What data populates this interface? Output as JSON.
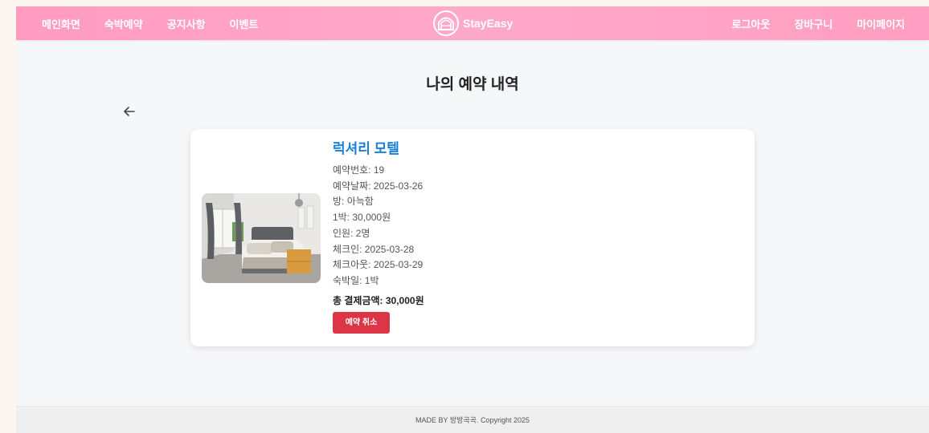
{
  "header": {
    "nav_left": [
      "메인화면",
      "숙박예약",
      "공지사항",
      "이벤트"
    ],
    "brand": "StayEasy",
    "nav_right": [
      "로그아웃",
      "장바구니",
      "마이페이지"
    ]
  },
  "page": {
    "title": "나의 예약 내역"
  },
  "reservation": {
    "hotel_name": "럭셔리 모텔",
    "lines": [
      "예약번호: 19",
      "예약날짜: 2025-03-26",
      "방: 아늑함",
      "1박: 30,000원",
      "인원: 2명",
      "체크인: 2025-03-28",
      "체크아웃: 2025-03-29",
      "숙박일: 1박"
    ],
    "total": "총 결제금액: 30,000원",
    "cancel_label": "예약 취소"
  },
  "footer": {
    "text": "MADE BY 방방곡곡. Copyright 2025"
  },
  "colors": {
    "header": "#ff9fc2",
    "hotel_name": "#1a7fd6",
    "cancel_button": "#dc3545"
  },
  "icons": {
    "back": "arrow-left-icon",
    "brand": "house-arch-logo"
  }
}
